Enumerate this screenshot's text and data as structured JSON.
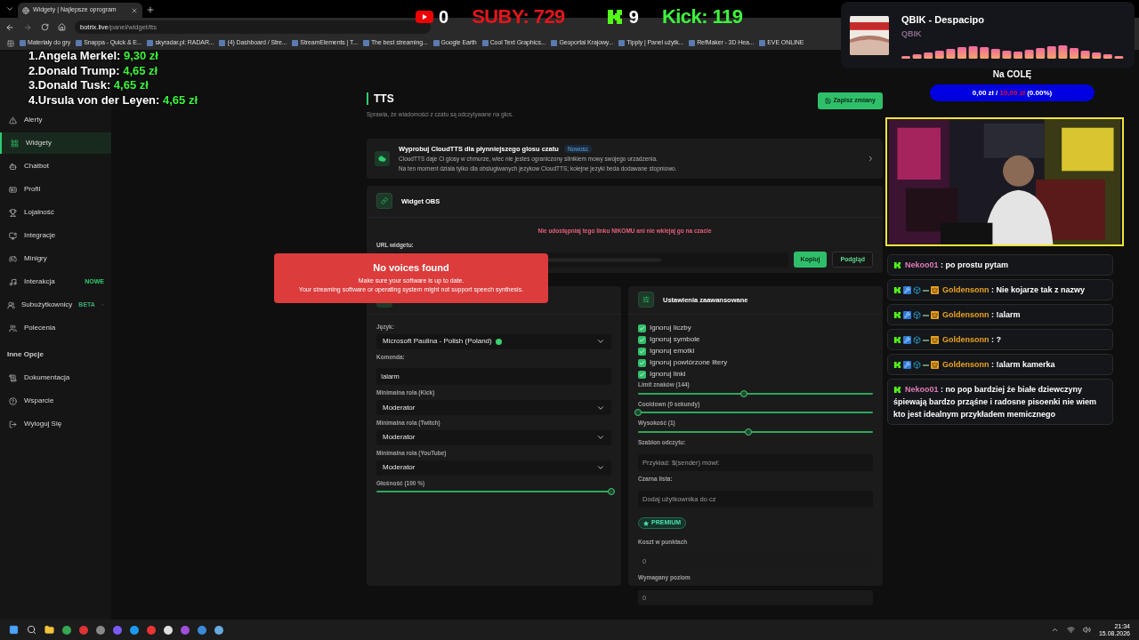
{
  "browser": {
    "tab": {
      "title": "Widgety | Najlepsze oprogram"
    },
    "address": {
      "domain": "botrix.live",
      "path": "/panel/widget/tts"
    },
    "bookmarks": [
      "Materiały do gry",
      "Snappa - Quick & E...",
      "skyradar.pl: RADAR...",
      "(4) Dashboard / Stre...",
      "StreamElements | T...",
      "The best streaming...",
      "Google Earth",
      "Cool Text Graphics...",
      "Geoportal Krajowy...",
      "Tipply | Panel użytk...",
      "RefMaker - 3D Hea...",
      "EVE ONLINE"
    ]
  },
  "sidebar": {
    "items": [
      {
        "label": "Alerty",
        "selected": false
      },
      {
        "label": "Widgety",
        "selected": true
      },
      {
        "label": "Chatbot",
        "selected": false
      },
      {
        "label": "Profil",
        "selected": false
      },
      {
        "label": "Lojalność",
        "selected": false
      },
      {
        "label": "Integracje",
        "selected": false
      },
      {
        "label": "Minigry",
        "selected": false
      },
      {
        "label": "Interakcja",
        "selected": false,
        "badge": "NOWE"
      },
      {
        "label": "Subużytkownicy",
        "selected": false,
        "badge": "BETA",
        "expanded": false
      },
      {
        "label": "Polecenia",
        "selected": false
      }
    ],
    "section_title": "Inne Opcje",
    "other_items": [
      {
        "label": "Dokumentacja"
      },
      {
        "label": "Wsparcie"
      },
      {
        "label": "Wyloguj Się"
      }
    ]
  },
  "page": {
    "title": "TTS",
    "subtitle": "Sprawia, że wiadomości z czatu są odczytywane na głos.",
    "save_button": "Zapisz zmiany",
    "cloud_banner": {
      "title": "Wyprobuj CloudTTS dla płynniejszego glosu czatu",
      "badge": "Nowosc",
      "lines": [
        "CloudTTS daje Ci glosy w chmurze, wiec nie jestes ograniczony silnikiem mowy swojego urzadzenia.",
        "Na ten moment dziala tylko dla obslugiwanych jezykow CloudTTS; kolejne jezyki beda dodawane stopniowo."
      ]
    },
    "widget_obs": {
      "title": "Widget OBS",
      "warning": "Nie udostępniaj tego linku NIKOMU ani nie wklejaj go na czacie",
      "url_label": "URL widgetu:",
      "buttons": [
        {
          "label": "Kopiuj",
          "kind": "primary"
        },
        {
          "label": "Podgląd",
          "kind": "outline"
        }
      ]
    },
    "basic_settings": {
      "fields": [
        {
          "kind": "voice_select",
          "label": "Język:",
          "value": "Microsoft Paulina - Polish (Poland)"
        },
        {
          "kind": "text",
          "label": "Komenda:",
          "value": "!alarm"
        },
        {
          "kind": "select",
          "label": "Minimalna rola (Kick)",
          "value": "Moderator"
        },
        {
          "kind": "select",
          "label": "Minimalna rola (Twitch)",
          "value": "Moderator"
        },
        {
          "kind": "select",
          "label": "Minimalna rola (YouTube)",
          "value": "Moderator"
        },
        {
          "kind": "slider",
          "label": "Głośność (100 %)",
          "level": 1
        }
      ]
    },
    "advanced_settings": {
      "title": "Ustawienia zaawansowane",
      "fields": [
        {
          "kind": "checkbox",
          "label": "Ignoruj liczby",
          "checked": true
        },
        {
          "kind": "checkbox",
          "label": "Ignoruj symbole",
          "checked": true
        },
        {
          "kind": "checkbox",
          "label": "Ignoruj emotki",
          "checked": true
        },
        {
          "kind": "checkbox",
          "label": "Ignoruj powtórzone litery",
          "checked": true
        },
        {
          "kind": "checkbox",
          "label": "Ignoruj linki",
          "checked": true
        },
        {
          "kind": "slider",
          "label": "Limit znaków (144)",
          "level": 0.45
        },
        {
          "kind": "slider",
          "label": "Cooldown (0 sekundy)",
          "level": 0
        },
        {
          "kind": "slider",
          "label": "Wysokość (1)",
          "level": 0.47
        },
        {
          "kind": "text",
          "label": "Szablon odczytu:",
          "placeholder": "Przykład: $(sender) mówi:"
        },
        {
          "kind": "text",
          "label": "Czarna lista:",
          "placeholder": "Dodaj użytkownika do cz"
        },
        {
          "kind": "premium",
          "label": "PREMIUM"
        },
        {
          "kind": "number",
          "label": "Koszt w punktach",
          "placeholder": "0"
        },
        {
          "kind": "number",
          "label": "Wymagany poziom",
          "placeholder": "0"
        }
      ]
    }
  },
  "toast": {
    "title": "No voices found",
    "lines": [
      "Make sure your software is up to date.",
      "Your streaming software or operating system might not support speech synthesis."
    ]
  },
  "overlays": {
    "counters": [
      {
        "kind": "youtube",
        "value": "0"
      },
      {
        "kind": "label",
        "text": "SUBY: 729",
        "color": "#e3161b"
      },
      {
        "kind": "kick",
        "value": "9"
      },
      {
        "kind": "label",
        "text": "Kick: 119",
        "color": "#3cf43c"
      }
    ],
    "leaderboard": [
      {
        "rank": "1.",
        "name": "Angela Merkel:",
        "amount": "9,30 zł"
      },
      {
        "rank": "2.",
        "name": "Donald Trump:",
        "amount": "4,65 zł"
      },
      {
        "rank": "3.",
        "name": "Donald Tusk:",
        "amount": "4,65 zł"
      },
      {
        "rank": "4.",
        "name": "Ursula von der Leyen:",
        "amount": "4,65 zł"
      }
    ],
    "now_playing": {
      "title": "QBIK - Despacipo",
      "artist": "QBIK"
    },
    "goal": {
      "title": "Na COLĘ",
      "current": "0,00 zł /",
      "target": "10,00 zł",
      "percent": "(0.00%)",
      "level": 0
    },
    "chat": [
      {
        "kind": "basic",
        "user": "Nekoo01",
        "color": "#e07bb5",
        "separator": ":",
        "text": "po prostu pytam"
      },
      {
        "kind": "badged",
        "user": "Goldensonn",
        "color": "#e8a21e",
        "separator": ":",
        "text": "Nie kojarze tak z nazwy"
      },
      {
        "kind": "badged",
        "user": "Goldensonn",
        "color": "#e8a21e",
        "separator": ":",
        "text": "!alarm"
      },
      {
        "kind": "badged",
        "user": "Goldensonn",
        "color": "#e8a21e",
        "separator": ":",
        "text": "?"
      },
      {
        "kind": "badged",
        "user": "Goldensonn",
        "color": "#e8a21e",
        "separator": ":",
        "text": "!alarm kamerka"
      },
      {
        "kind": "basic",
        "user": "Nekoo01",
        "color": "#e07bb5",
        "separator": ":",
        "text": "no pop bardziej że białe dziewczyny śpiewają bardzo prząśne i radosne pisoenki nie wiem kto jest idealnym przykładem memicznego"
      }
    ]
  },
  "taskbar": {
    "time": "21:34",
    "date": "15.08.2026"
  }
}
